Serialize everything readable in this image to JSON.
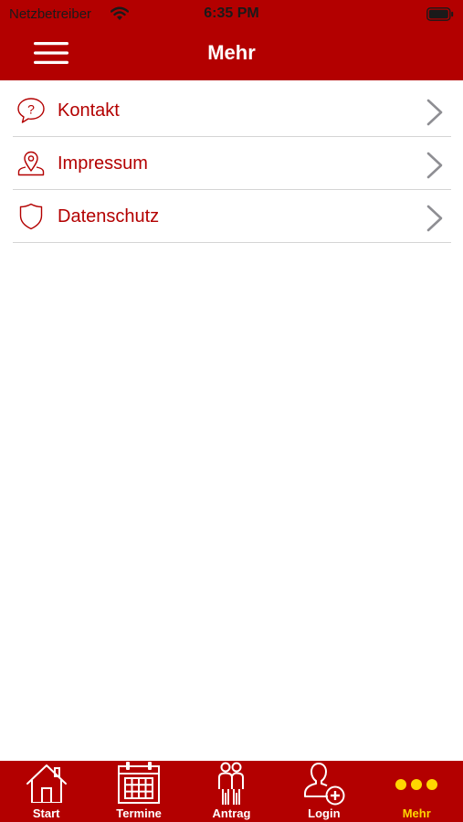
{
  "status_bar": {
    "carrier": "Netzbetreiber",
    "time": "6:35 PM"
  },
  "nav": {
    "title": "Mehr",
    "menu_icon": "hamburger-menu-icon"
  },
  "menu_items": [
    {
      "label": "Kontakt",
      "icon": "speech-bubble-question-icon"
    },
    {
      "label": "Impressum",
      "icon": "map-pin-person-icon"
    },
    {
      "label": "Datenschutz",
      "icon": "shield-icon"
    }
  ],
  "tabs": [
    {
      "label": "Start",
      "icon": "house-icon",
      "active": false
    },
    {
      "label": "Termine",
      "icon": "calendar-icon",
      "active": false
    },
    {
      "label": "Antrag",
      "icon": "people-icon",
      "active": false
    },
    {
      "label": "Login",
      "icon": "user-add-icon",
      "active": false
    },
    {
      "label": "Mehr",
      "icon": "more-dots-icon",
      "active": true
    }
  ],
  "colors": {
    "brand_red": "#b30000",
    "active_tab": "#ffd700",
    "divider": "#d4d4d4",
    "chevron": "#8e8e93"
  }
}
